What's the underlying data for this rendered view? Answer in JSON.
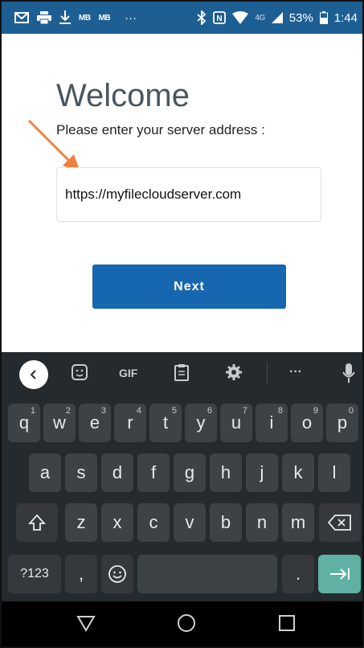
{
  "status_bar": {
    "time": "1:44",
    "battery": "53%",
    "network": "4G",
    "overflow": "···"
  },
  "welcome": {
    "title": "Welcome",
    "prompt": "Please enter your server address :"
  },
  "server_input": {
    "value": "https://myfilecloudserver.com"
  },
  "next_button": {
    "label": "Next"
  },
  "keyboard": {
    "toolbar": {
      "gif": "GIF",
      "more": "···"
    },
    "row1": [
      {
        "k": "q",
        "h": "1"
      },
      {
        "k": "w",
        "h": "2"
      },
      {
        "k": "e",
        "h": "3"
      },
      {
        "k": "r",
        "h": "4"
      },
      {
        "k": "t",
        "h": "5"
      },
      {
        "k": "y",
        "h": "6"
      },
      {
        "k": "u",
        "h": "7"
      },
      {
        "k": "i",
        "h": "8"
      },
      {
        "k": "o",
        "h": "9"
      },
      {
        "k": "p",
        "h": "0"
      }
    ],
    "row2": [
      "a",
      "s",
      "d",
      "f",
      "g",
      "h",
      "j",
      "k",
      "l"
    ],
    "row3": [
      "z",
      "x",
      "c",
      "v",
      "b",
      "n",
      "m"
    ],
    "symbols_key": "?123",
    "comma_key": ",",
    "period_key": "."
  },
  "colors": {
    "status_bar": "#1d5f92",
    "button": "#1766b0",
    "keyboard_bg": "#252a2e",
    "key_bg": "#3d4246",
    "enter_key": "#5fb1a4",
    "arrow": "#f08040"
  }
}
